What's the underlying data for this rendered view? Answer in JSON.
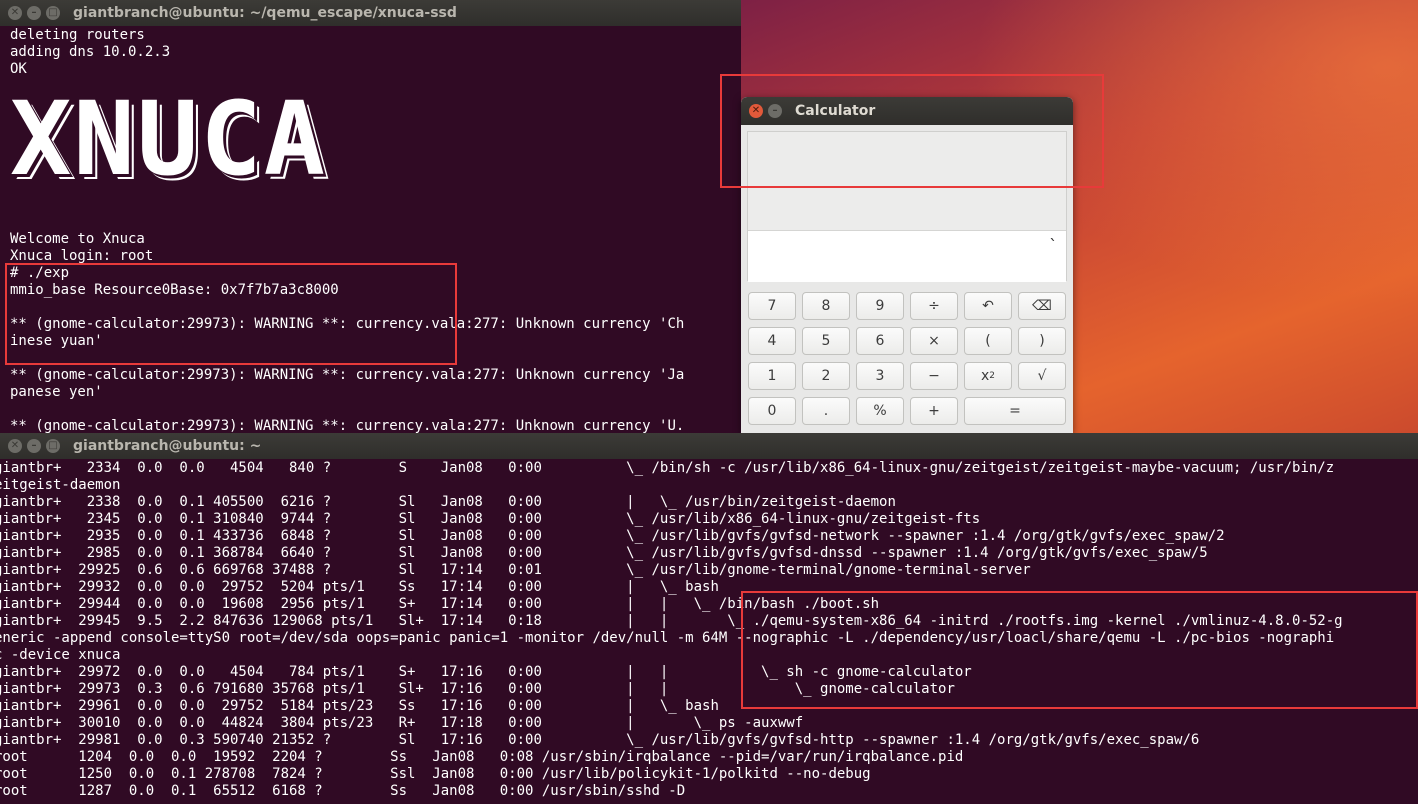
{
  "top_terminal": {
    "title": "giantbranch@ubuntu: ~/qemu_escape/xnuca-ssd",
    "banner": "XNUCA",
    "lines_before_banner": [
      "deleting routers",
      "adding dns 10.0.2.3",
      "OK"
    ],
    "lines_after_banner": [
      "Welcome to Xnuca",
      "Xnuca login: root",
      "# ./exp",
      "mmio_base Resource0Base: 0x7f7b7a3c8000",
      "",
      "** (gnome-calculator:29973): WARNING **: currency.vala:277: Unknown currency 'Ch",
      "inese yuan'",
      "",
      "** (gnome-calculator:29973): WARNING **: currency.vala:277: Unknown currency 'Ja",
      "panese yen'",
      "",
      "** (gnome-calculator:29973): WARNING **: currency.vala:277: Unknown currency 'U."
    ]
  },
  "calculator": {
    "title": "Calculator",
    "display_input": "`",
    "keys": [
      [
        "7",
        "8",
        "9",
        "÷",
        "↶",
        "⌫"
      ],
      [
        "4",
        "5",
        "6",
        "×",
        "(",
        ")"
      ],
      [
        "1",
        "2",
        "3",
        "−",
        "x²",
        "√"
      ],
      [
        "0",
        ".",
        "%",
        "+",
        "="
      ]
    ]
  },
  "bottom_terminal": {
    "title": "giantbranch@ubuntu: ~",
    "lines": [
      "giantbr+   2334  0.0  0.0   4504   840 ?        S    Jan08   0:00          \\_ /bin/sh -c /usr/lib/x86_64-linux-gnu/zeitgeist/zeitgeist-maybe-vacuum; /usr/bin/z",
      "eitgeist-daemon",
      "giantbr+   2338  0.0  0.1 405500  6216 ?        Sl   Jan08   0:00          |   \\_ /usr/bin/zeitgeist-daemon",
      "giantbr+   2345  0.0  0.1 310840  9744 ?        Sl   Jan08   0:00          \\_ /usr/lib/x86_64-linux-gnu/zeitgeist-fts",
      "giantbr+   2935  0.0  0.1 433736  6848 ?        Sl   Jan08   0:00          \\_ /usr/lib/gvfs/gvfsd-network --spawner :1.4 /org/gtk/gvfs/exec_spaw/2",
      "giantbr+   2985  0.0  0.1 368784  6640 ?        Sl   Jan08   0:00          \\_ /usr/lib/gvfs/gvfsd-dnssd --spawner :1.4 /org/gtk/gvfs/exec_spaw/5",
      "giantbr+  29925  0.6  0.6 669768 37488 ?        Sl   17:14   0:01          \\_ /usr/lib/gnome-terminal/gnome-terminal-server",
      "giantbr+  29932  0.0  0.0  29752  5204 pts/1    Ss   17:14   0:00          |   \\_ bash",
      "giantbr+  29944  0.0  0.0  19608  2956 pts/1    S+   17:14   0:00          |   |   \\_ /bin/bash ./boot.sh",
      "giantbr+  29945  9.5  2.2 847636 129068 pts/1   Sl+  17:14   0:18          |   |       \\_ ./qemu-system-x86_64 -initrd ./rootfs.img -kernel ./vmlinuz-4.8.0-52-g",
      "eneric -append console=ttyS0 root=/dev/sda oops=panic panic=1 -monitor /dev/null -m 64M --nographic -L ./dependency/usr/loacl/share/qemu -L ./pc-bios -nographi",
      "c -device xnuca",
      "giantbr+  29972  0.0  0.0   4504   784 pts/1    S+   17:16   0:00          |   |           \\_ sh -c gnome-calculator",
      "giantbr+  29973  0.3  0.6 791680 35768 pts/1    Sl+  17:16   0:00          |   |               \\_ gnome-calculator",
      "giantbr+  29961  0.0  0.0  29752  5184 pts/23   Ss   17:16   0:00          |   \\_ bash",
      "giantbr+  30010  0.0  0.0  44824  3804 pts/23   R+   17:18   0:00          |       \\_ ps -auxwwf",
      "giantbr+  29981  0.0  0.3 590740 21352 ?        Sl   17:16   0:00          \\_ /usr/lib/gvfs/gvfsd-http --spawner :1.4 /org/gtk/gvfs/exec_spaw/6",
      "root      1204  0.0  0.0  19592  2204 ?        Ss   Jan08   0:08 /usr/sbin/irqbalance --pid=/var/run/irqbalance.pid",
      "root      1250  0.0  0.1 278708  7824 ?        Ssl  Jan08   0:00 /usr/lib/policykit-1/polkitd --no-debug",
      "root      1287  0.0  0.1  65512  6168 ?        Ss   Jan08   0:00 /usr/sbin/sshd -D"
    ]
  }
}
